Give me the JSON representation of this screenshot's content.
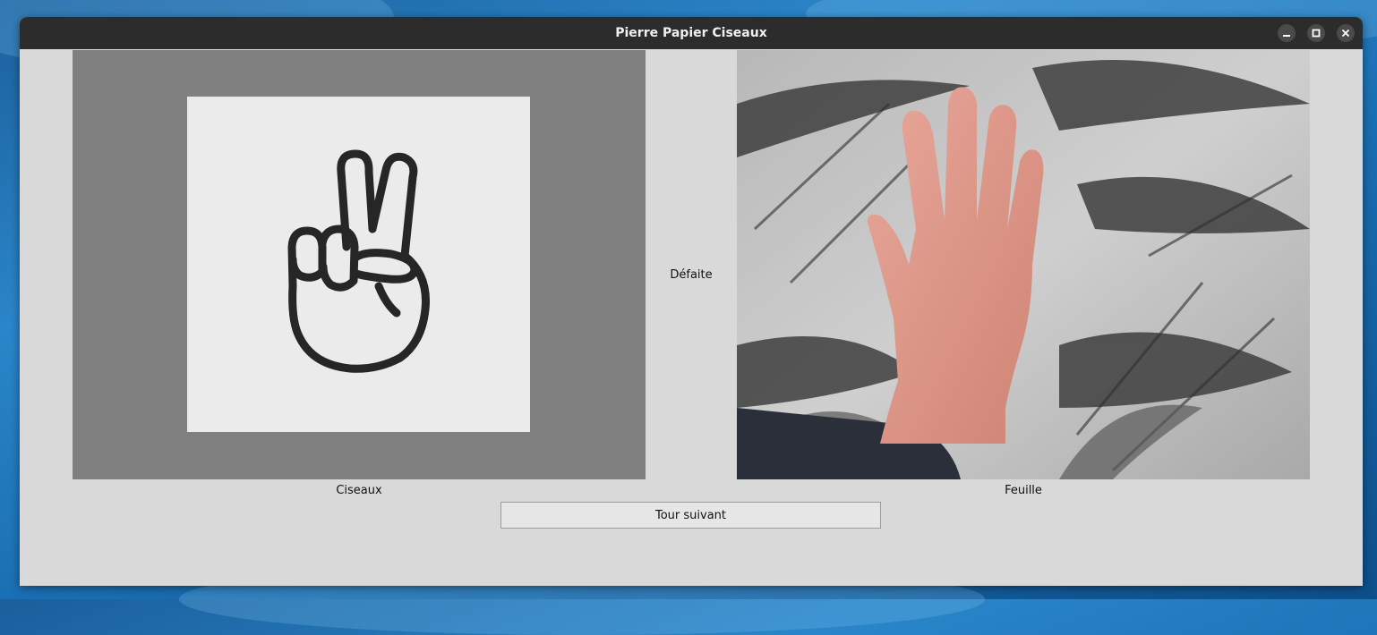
{
  "window": {
    "title": "Pierre Papier Ciseaux"
  },
  "titlebar": {
    "minimize_icon": "minimize-icon",
    "maximize_icon": "maximize-icon",
    "close_icon": "close-icon"
  },
  "computer": {
    "choice_label": "Ciseaux",
    "image_icon": "scissors-hand-icon"
  },
  "result": {
    "text": "Défaite"
  },
  "player": {
    "choice_label": "Feuille",
    "image": "webcam-open-hand-photo"
  },
  "controls": {
    "next_round_label": "Tour suivant"
  },
  "colors": {
    "titlebar_bg": "#2c2c2c",
    "window_bg": "#d9d9d9",
    "panel_bg": "#808080",
    "card_bg": "#ebebeb"
  }
}
